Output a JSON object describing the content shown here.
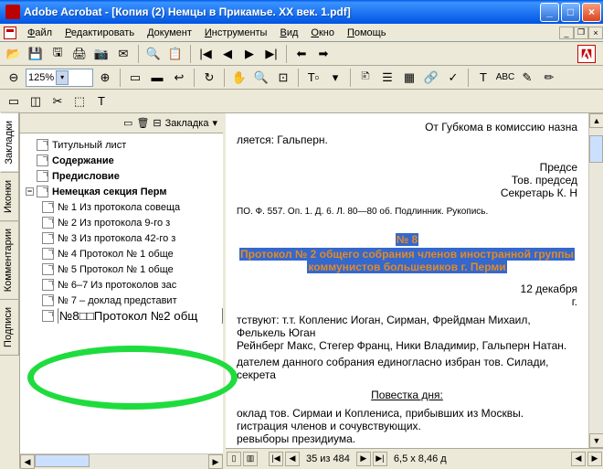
{
  "window": {
    "title": "Adobe Acrobat - [Копия (2) Немцы в Прикамье. XX век. 1.pdf]"
  },
  "menu": {
    "file": "Файл",
    "edit": "Редактировать",
    "document": "Документ",
    "tools": "Инструменты",
    "view": "Вид",
    "window": "Окно",
    "help": "Помощь"
  },
  "toolbar2": {
    "zoom_value": "125%"
  },
  "sidetabs": {
    "bookmarks": "Закладки",
    "icons": "Иконки",
    "comments": "Комментарии",
    "signatures": "Подписи"
  },
  "bookmarks_header": {
    "label": "Закладка",
    "arrow": "▾"
  },
  "bookmarks": [
    {
      "label": "Титульный лист",
      "level": 0,
      "bold": false
    },
    {
      "label": "Содержание",
      "level": 0,
      "bold": true
    },
    {
      "label": "Предисловие",
      "level": 0,
      "bold": true
    },
    {
      "label": "Немецкая секция Перм",
      "level": 0,
      "bold": true
    },
    {
      "label": "№ 1 Из протокола совеща",
      "level": 1,
      "bold": false
    },
    {
      "label": "№ 2 Из протокола 9-го з",
      "level": 1,
      "bold": false
    },
    {
      "label": "№ 3 Из протокола 42-го з",
      "level": 1,
      "bold": false
    },
    {
      "label": "№ 4 Протокол № 1 обще",
      "level": 1,
      "bold": false
    },
    {
      "label": "№ 5 Протокол № 1 обще",
      "level": 1,
      "bold": false
    },
    {
      "label": "№ 6–7 Из протоколов зас",
      "level": 1,
      "bold": false
    },
    {
      "label": "№ 7 – доклад представит",
      "level": 1,
      "bold": false
    },
    {
      "label": "№8□□Протокол №2 общ",
      "level": 1,
      "bold": false,
      "editing": true
    }
  ],
  "document_text": {
    "line1": "От Губкома в комиссию назна",
    "line2": "ляется: Гальперн.",
    "line3": "Предсе",
    "line4": "Тов. председ",
    "line5": "Секретарь К. Н",
    "archive": "ПО. Ф. 557. Оп. 1. Д. 6. Л. 80—80 об. Подлинник. Рукопись.",
    "doc_num": "№ 8",
    "doc_title1": "Протокол № 2 общего собрания членов иностранной группы",
    "doc_title2": "коммунистов большевиков г. Перми",
    "date": "12 декабря",
    "year": "г.",
    "present": "тствуют: т.т. Копленис Иоган, Сирман, Фрейдман Михаил, Фелькель Юган",
    "present2": "Рейнберг Макс, Стегер Франц, Ники Владимир, Гальперн Натан.",
    "chair": "дателем данного собрания единогласно избран тов. Силади, секрета",
    "agenda_title": "Повестка дня:",
    "agenda1": "оклад тов. Сирмаи и Коплениса, прибывших из Москвы.",
    "agenda2": "гистрация членов и сочувствующих.",
    "agenda3": "ревыборы президиума."
  },
  "status": {
    "page_label": "35 из 484",
    "dims": "6,5 x 8,46 д"
  }
}
